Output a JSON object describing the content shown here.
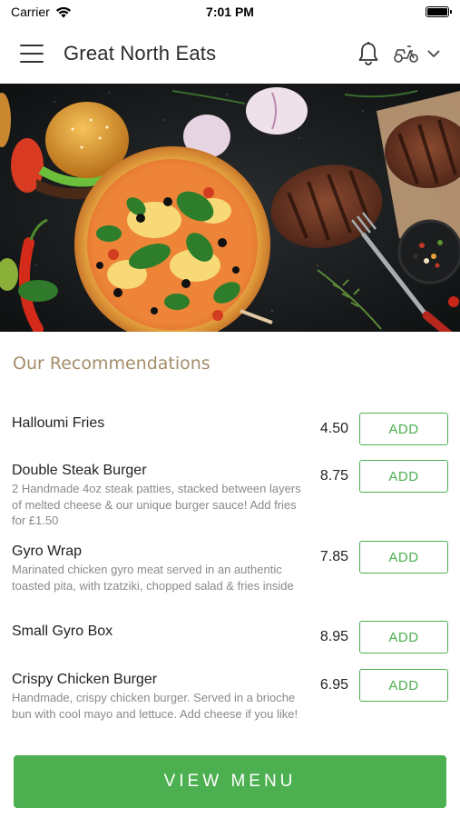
{
  "status_bar": {
    "carrier": "Carrier",
    "time": "7:01 PM",
    "battery_level": 1.0
  },
  "header": {
    "title": "Great North Eats",
    "icons": [
      "menu-icon",
      "bell-icon",
      "scooter-icon",
      "chevron-down-icon"
    ]
  },
  "hero": {
    "image": "food-banner-burger-pizza-steak"
  },
  "recommendations": {
    "title": "Our Recommendations",
    "add_label": "ADD",
    "items": [
      {
        "name": "Halloumi Fries",
        "description": "",
        "price": "4.50"
      },
      {
        "name": "Double Steak Burger",
        "description": "2 Handmade 4oz steak patties, stacked between layers of melted cheese & our unique burger sauce! Add fries for £1.50",
        "price": "8.75"
      },
      {
        "name": "Gyro Wrap",
        "description": "Marinated chicken gyro meat served in an authentic toasted pita, with tzatziki, chopped salad & fries inside",
        "price": "7.85"
      },
      {
        "name": "Small Gyro Box",
        "description": "",
        "price": "8.95"
      },
      {
        "name": "Crispy Chicken Burger",
        "description": "Handmade, crispy chicken burger. Served in a brioche bun with cool mayo and lettuce. Add cheese if you like!",
        "price": "6.95"
      }
    ]
  },
  "footer": {
    "view_menu_label": "VIEW MENU"
  },
  "colors": {
    "accent_green": "#4caf50",
    "section_title": "#a48d6a"
  }
}
